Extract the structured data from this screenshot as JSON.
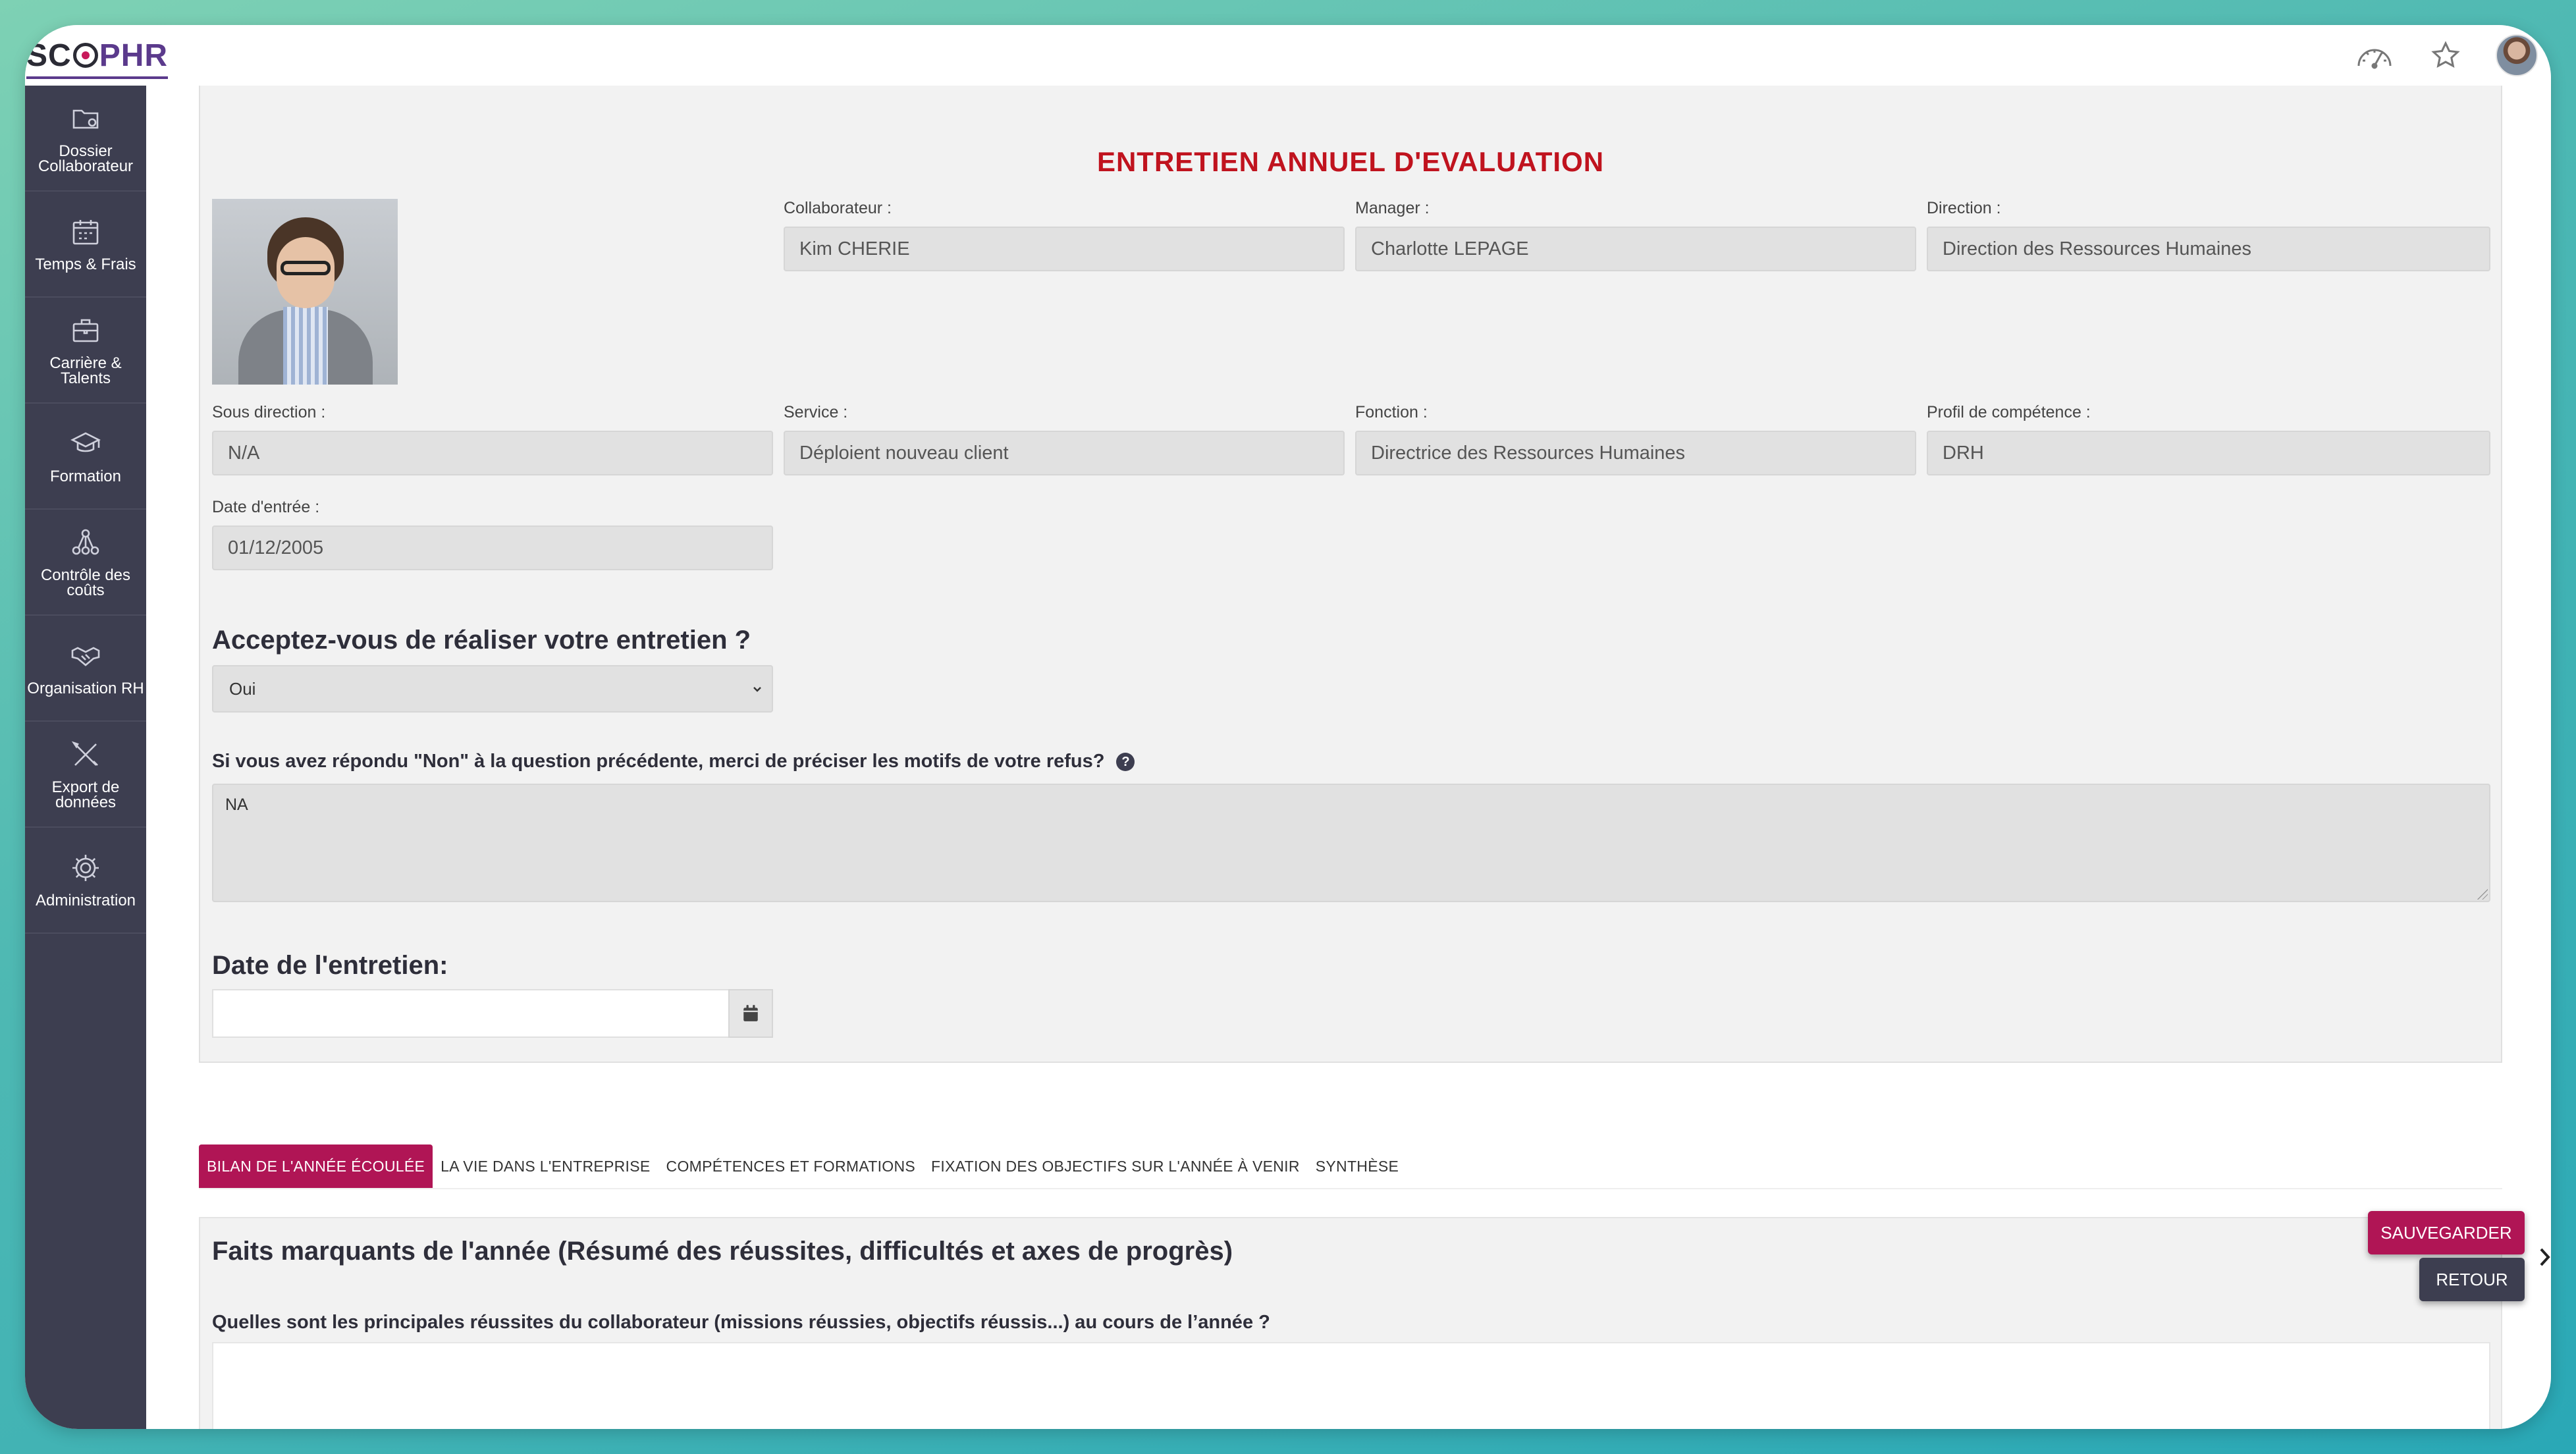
{
  "brand": {
    "logo_left": "SC",
    "logo_right": "PHR"
  },
  "topbar": {
    "icons": [
      "dashboard-gauge-icon",
      "star-icon",
      "user-avatar"
    ]
  },
  "sidebar": {
    "items": [
      {
        "label": "Dossier Collaborateur",
        "icon": "folder-icon"
      },
      {
        "label": "Temps & Frais",
        "icon": "calendar-icon"
      },
      {
        "label": "Carrière & Talents",
        "icon": "briefcase-icon"
      },
      {
        "label": "Formation",
        "icon": "graduation-cap-icon"
      },
      {
        "label": "Contrôle des coûts",
        "icon": "network-icon"
      },
      {
        "label": "Organisation RH",
        "icon": "handshake-icon"
      },
      {
        "label": "Export de données",
        "icon": "tools-icon"
      },
      {
        "label": "Administration",
        "icon": "gear-icon"
      }
    ]
  },
  "form": {
    "title": "ENTRETIEN ANNUEL D'EVALUATION",
    "fields": {
      "collaborateur": {
        "label": "Collaborateur :",
        "value": "Kim CHERIE"
      },
      "manager": {
        "label": "Manager :",
        "value": "Charlotte LEPAGE"
      },
      "direction": {
        "label": "Direction :",
        "value": "Direction des Ressources Humaines"
      },
      "sous_direction": {
        "label": "Sous direction :",
        "value": "N/A"
      },
      "service": {
        "label": "Service :",
        "value": "Déploient nouveau client"
      },
      "fonction": {
        "label": "Fonction :",
        "value": "Directrice des Ressources Humaines"
      },
      "profil": {
        "label": "Profil de compétence :",
        "value": "DRH"
      },
      "date_entree": {
        "label": "Date d'entrée :",
        "value": "01/12/2005"
      }
    },
    "accept_question": "Acceptez-vous de réaliser votre entretien ?",
    "accept_value": "Oui",
    "refusal_question": "Si vous avez répondu \"Non\" à la question précédente, merci de préciser les motifs de votre refus?",
    "refusal_value": "NA",
    "date_question": "Date de l'entretien:",
    "date_value": ""
  },
  "tabs": [
    {
      "label": "BILAN DE L'ANNÉE ÉCOULÉE",
      "active": true
    },
    {
      "label": "LA VIE DANS L'ENTREPRISE",
      "active": false
    },
    {
      "label": "COMPÉTENCES ET FORMATIONS",
      "active": false
    },
    {
      "label": "FIXATION DES OBJECTIFS SUR L'ANNÉE À VENIR",
      "active": false
    },
    {
      "label": "SYNTHÈSE",
      "active": false
    }
  ],
  "section": {
    "title": "Faits marquants de l'année (Résumé des réussites, difficultés et axes de progrès)",
    "question": "Quelles sont les principales réussites du collaborateur (missions réussies, objectifs réussis...) au cours de l’année ?"
  },
  "actions": {
    "save_label": "SAUVEGARDER",
    "back_label": "RETOUR"
  },
  "colors": {
    "accent": "#b01555",
    "sidebar": "#3d3e50",
    "title_red": "#c0131e"
  }
}
